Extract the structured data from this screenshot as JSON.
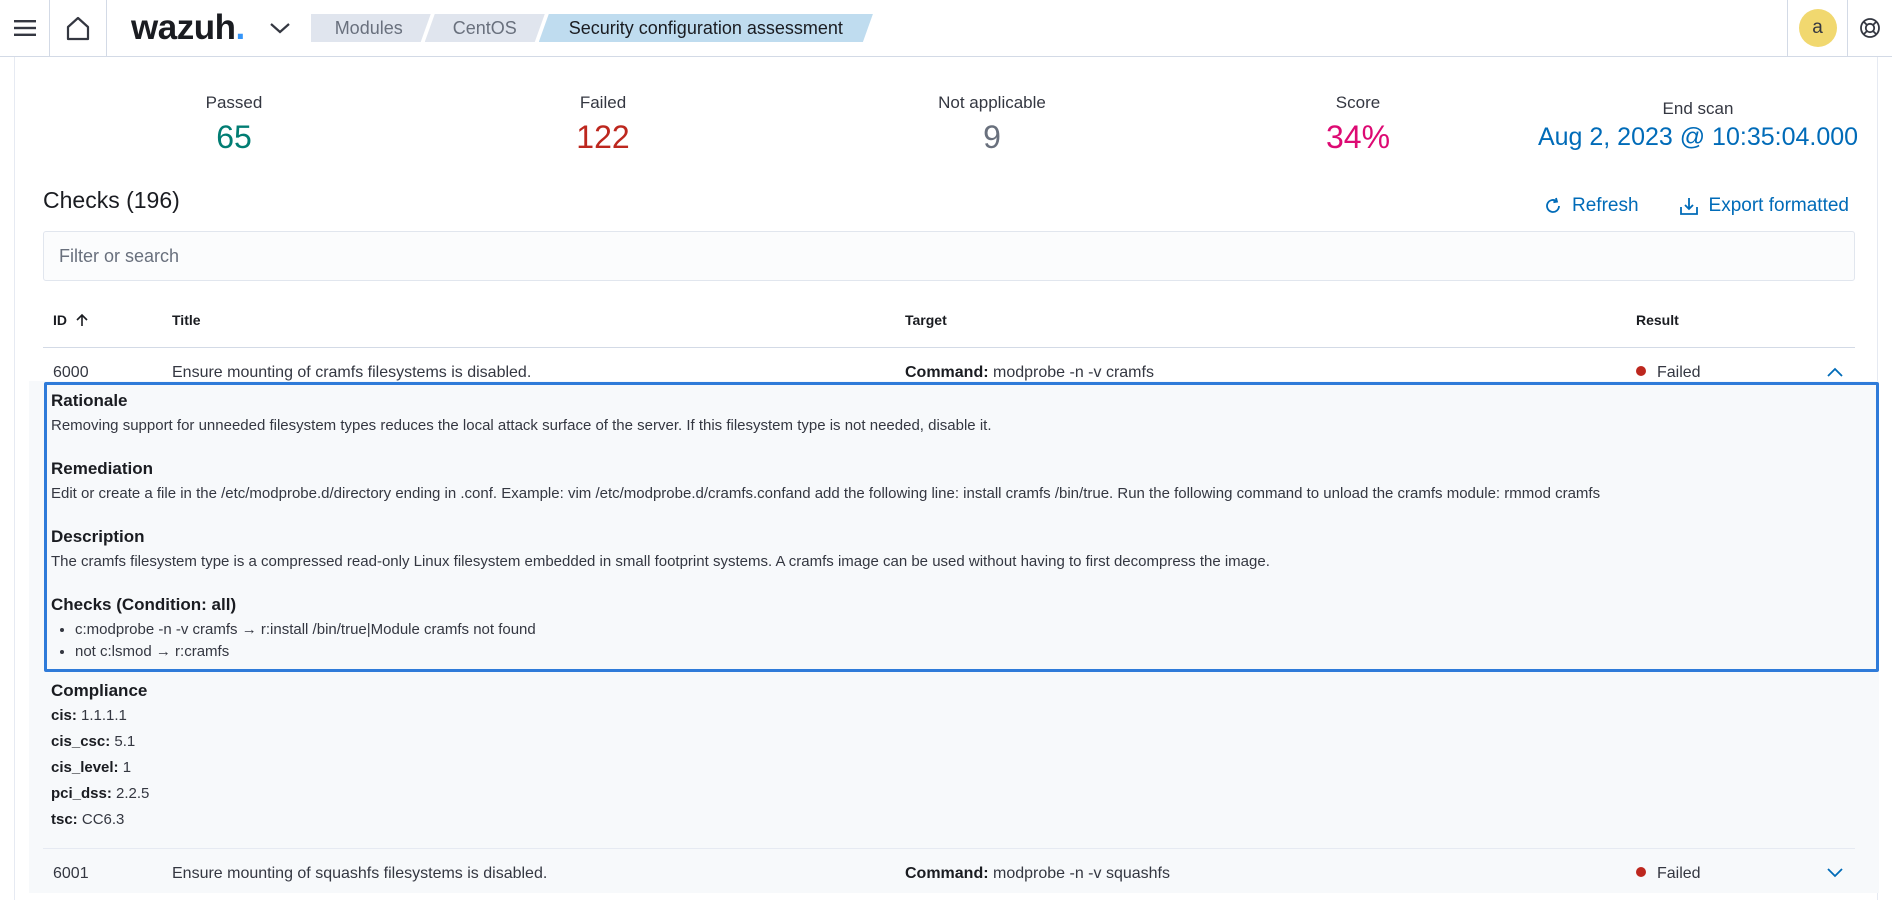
{
  "header": {
    "logo_text": "wazuh",
    "logo_dot": ".",
    "breadcrumbs": [
      {
        "label": "Modules"
      },
      {
        "label": "CentOS"
      },
      {
        "label": "Security configuration assessment"
      }
    ],
    "avatar_initial": "a"
  },
  "stats": {
    "passed": {
      "label": "Passed",
      "value": "65"
    },
    "failed": {
      "label": "Failed",
      "value": "122"
    },
    "not_applicable": {
      "label": "Not applicable",
      "value": "9"
    },
    "score": {
      "label": "Score",
      "value": "34%"
    },
    "end_scan": {
      "label": "End scan",
      "value": "Aug 2, 2023 @ 10:35:04.000"
    }
  },
  "checks": {
    "title": "Checks (196)",
    "refresh_label": "Refresh",
    "export_label": "Export formatted",
    "search_placeholder": "Filter or search",
    "columns": {
      "id": "ID",
      "title": "Title",
      "target": "Target",
      "result": "Result"
    },
    "rows": [
      {
        "id": "6000",
        "title": "Ensure mounting of cramfs filesystems is disabled.",
        "target_label": "Command:",
        "target_value": "modprobe -n -v cramfs",
        "result": "Failed"
      },
      {
        "id": "6001",
        "title": "Ensure mounting of squashfs filesystems is disabled.",
        "target_label": "Command:",
        "target_value": "modprobe -n -v squashfs",
        "result": "Failed"
      }
    ]
  },
  "details": {
    "rationale_title": "Rationale",
    "rationale": "Removing support for unneeded filesystem types reduces the local attack surface of the server. If this filesystem type is not needed, disable it.",
    "remediation_title": "Remediation",
    "remediation": "Edit or create a file in the /etc/modprobe.d/directory ending in .conf. Example: vim /etc/modprobe.d/cramfs.confand add the following line: install cramfs /bin/true. Run the following command to unload the cramfs module: rmmod cramfs",
    "description_title": "Description",
    "description": "The cramfs filesystem type is a compressed read-only Linux filesystem embedded in small footprint systems. A cramfs image can be used without having to first decompress the image.",
    "checks_title": "Checks (Condition: all)",
    "checks": [
      "c:modprobe -n -v cramfs → r:install /bin/true|Module cramfs not found",
      "not c:lsmod → r:cramfs"
    ],
    "compliance_title": "Compliance",
    "compliance": [
      {
        "key": "cis:",
        "value": "1.1.1.1"
      },
      {
        "key": "cis_csc:",
        "value": "5.1"
      },
      {
        "key": "cis_level:",
        "value": "1"
      },
      {
        "key": "pci_dss:",
        "value": "2.2.5"
      },
      {
        "key": "tsc:",
        "value": "CC6.3"
      }
    ]
  }
}
